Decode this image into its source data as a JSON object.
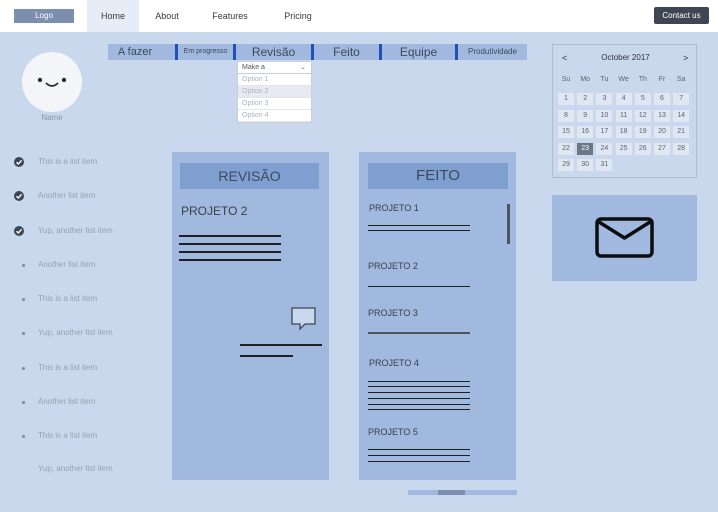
{
  "nav": {
    "logo": "Logo",
    "tabs": [
      "Home",
      "About",
      "Features",
      "Pricing"
    ],
    "active_tab": "Home",
    "contact": "Contact us"
  },
  "profile": {
    "name": "Name"
  },
  "filters": [
    "A fazer",
    "Em progresso",
    "Revisão",
    "Feito",
    "Equipe",
    "Produtividade"
  ],
  "dropdown": {
    "selected": "Make a",
    "options": [
      "Option 1",
      "Option 2",
      "Option 3",
      "Option 4"
    ]
  },
  "list": [
    {
      "text": "This is a list item",
      "checked": true
    },
    {
      "text": "Another list item",
      "checked": true
    },
    {
      "text": "Yup, another list item",
      "checked": true
    },
    {
      "text": "Another list item",
      "checked": false
    },
    {
      "text": "This is a list item",
      "checked": false
    },
    {
      "text": "Yup, another list item",
      "checked": false
    },
    {
      "text": "This is a list item",
      "checked": false
    },
    {
      "text": "Another list item",
      "checked": false
    },
    {
      "text": "This is a list item",
      "checked": false
    },
    {
      "text": "Yup, another list item",
      "checked": false
    }
  ],
  "revisao": {
    "title": "REVISÃO",
    "project": "PROJETO 2"
  },
  "feito": {
    "title": "FEITO",
    "projects": [
      "PROJETO 1",
      "PROJETO 2",
      "PROJETO 3",
      "PROJETO 4",
      "PROJETO 5"
    ]
  },
  "calendar": {
    "month": "October 2017",
    "prev": "<",
    "next": ">",
    "weekdays": [
      "Su",
      "Mo",
      "Tu",
      "We",
      "Th",
      "Fr",
      "Sa"
    ],
    "weeks": [
      [
        "1",
        "2",
        "3",
        "4",
        "5",
        "6",
        "7"
      ],
      [
        "8",
        "9",
        "10",
        "11",
        "12",
        "13",
        "14"
      ],
      [
        "15",
        "16",
        "17",
        "18",
        "19",
        "20",
        "21"
      ],
      [
        "22",
        "23",
        "24",
        "25",
        "26",
        "27",
        "28"
      ],
      [
        "29",
        "30",
        "31"
      ]
    ],
    "selected_day": "23"
  },
  "icons": {
    "chat": "speech-bubble-icon",
    "mail": "envelope-icon",
    "check": "check-circle-icon"
  },
  "colors": {
    "background": "#c9d8ec",
    "panel": "#a1b9de",
    "panel_header": "#7e9fcf",
    "tab_bar": "#2350b8",
    "dark_button": "#3e4653"
  }
}
